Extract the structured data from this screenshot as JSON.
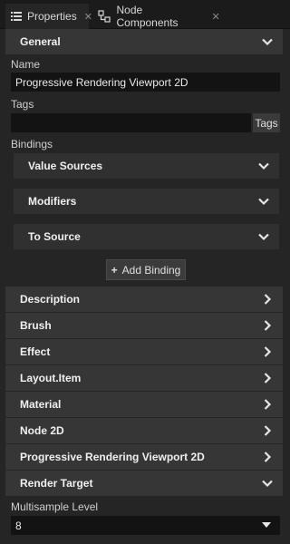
{
  "tabs": [
    {
      "label": "Properties",
      "icon": "list-icon",
      "active": true
    },
    {
      "label": "Node Components",
      "icon": "node-components-icon",
      "active": false
    }
  ],
  "general": {
    "title": "General",
    "name_label": "Name",
    "name_value": "Progressive Rendering Viewport 2D",
    "tags_label": "Tags",
    "tags_value": "",
    "tags_button": "Tags",
    "bindings_label": "Bindings",
    "bindings": [
      {
        "label": "Value Sources"
      },
      {
        "label": "Modifiers"
      },
      {
        "label": "To Source"
      }
    ],
    "add_binding": "Add Binding"
  },
  "sections": [
    {
      "label": "Description"
    },
    {
      "label": "Brush"
    },
    {
      "label": "Effect"
    },
    {
      "label": "Layout.Item"
    },
    {
      "label": "Material"
    },
    {
      "label": "Node 2D"
    },
    {
      "label": "Progressive Rendering Viewport 2D"
    }
  ],
  "render_target": {
    "title": "Render Target",
    "multisample_label": "Multisample Level",
    "multisample_value": "8"
  },
  "colors": {
    "background": "#252525",
    "section_header": "#363636",
    "field": "#131313"
  }
}
